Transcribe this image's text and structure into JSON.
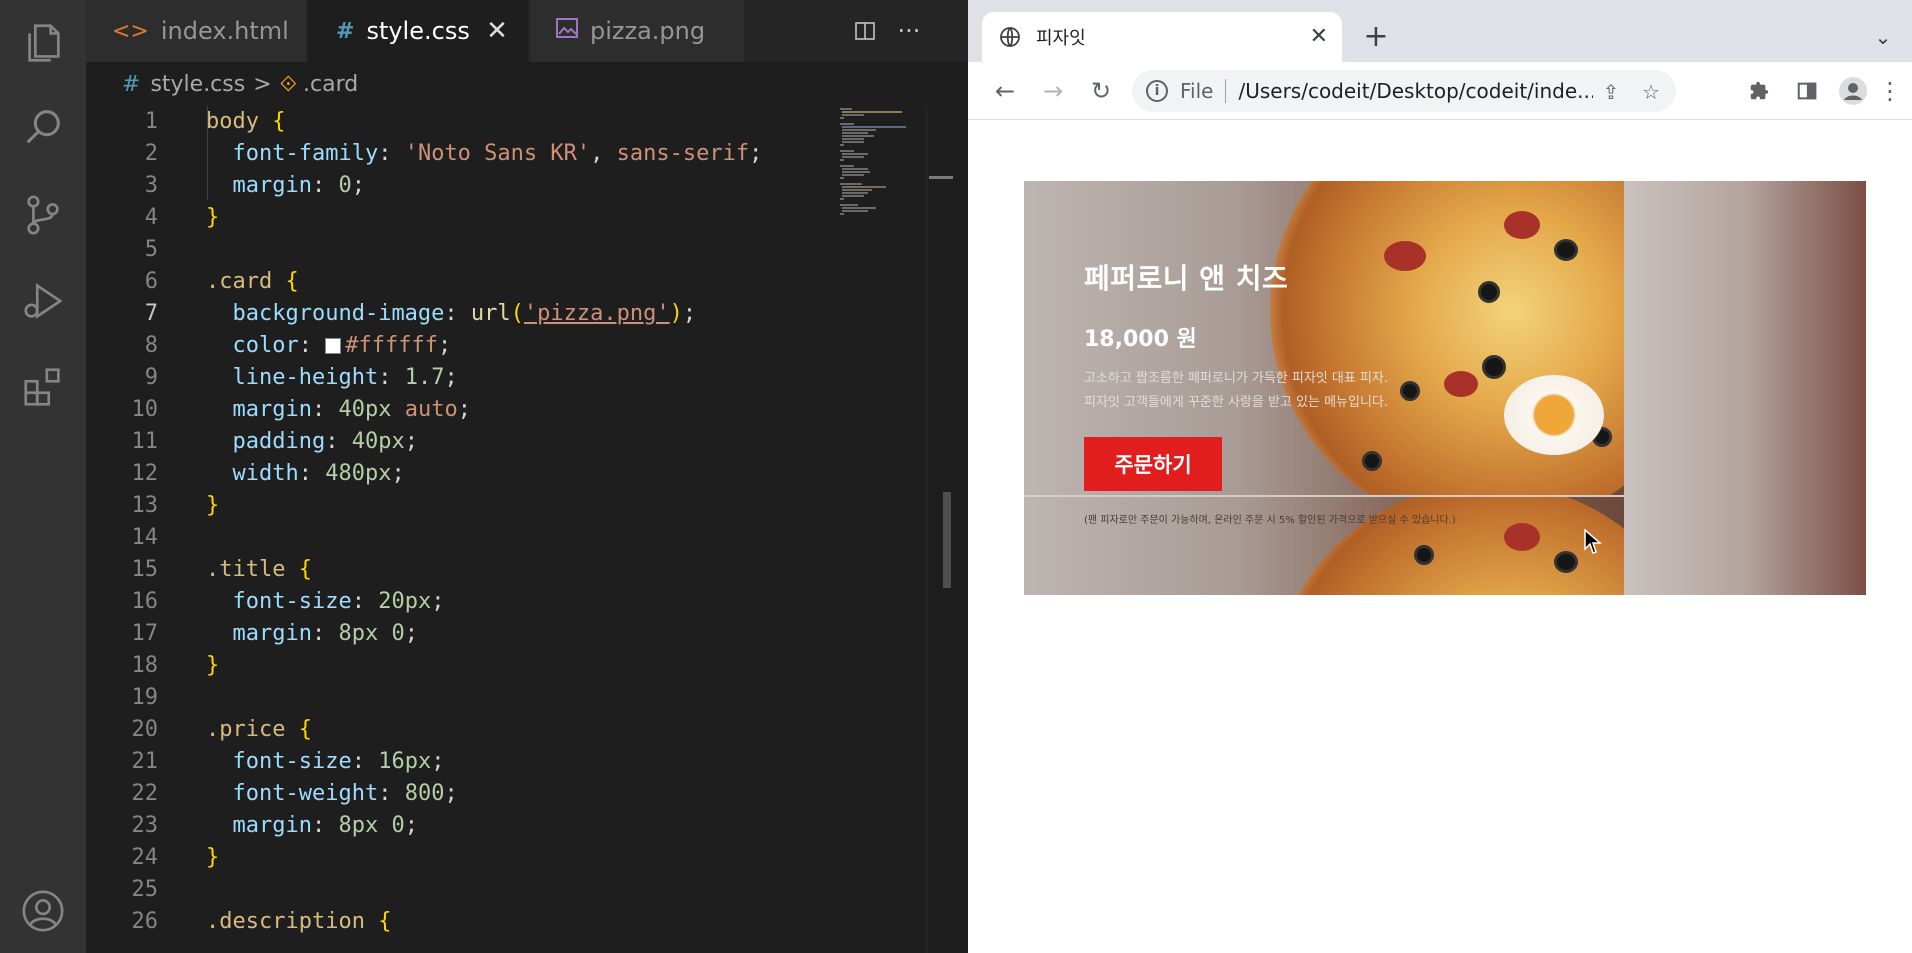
{
  "vscode": {
    "tabs": [
      {
        "label": "index.html",
        "icon": "<>"
      },
      {
        "label": "style.css",
        "icon": "#"
      },
      {
        "label": "pizza.png",
        "icon": "image-icon"
      }
    ],
    "tab_close_glyph": "✕",
    "more_glyph": "···",
    "breadcrumb": {
      "file": "style.css",
      "symbol": ".card",
      "hash": "#",
      "sep": ">",
      "sym_icon": "⟐"
    },
    "current_line": 7,
    "lines": [
      {
        "n": "1"
      },
      {
        "n": "2"
      },
      {
        "n": "3"
      },
      {
        "n": "4"
      },
      {
        "n": "5"
      },
      {
        "n": "6"
      },
      {
        "n": "7"
      },
      {
        "n": "8"
      },
      {
        "n": "9"
      },
      {
        "n": "10"
      },
      {
        "n": "11"
      },
      {
        "n": "12"
      },
      {
        "n": "13"
      },
      {
        "n": "14"
      },
      {
        "n": "15"
      },
      {
        "n": "16"
      },
      {
        "n": "17"
      },
      {
        "n": "18"
      },
      {
        "n": "19"
      },
      {
        "n": "20"
      },
      {
        "n": "21"
      },
      {
        "n": "22"
      },
      {
        "n": "23"
      },
      {
        "n": "24"
      },
      {
        "n": "25"
      },
      {
        "n": "26"
      }
    ],
    "code": {
      "l1_sel": "body",
      "l1_brace": " {",
      "l2_prop": "font-family",
      "l2_val1": "'Noto Sans KR'",
      "l2_val2": "sans-serif",
      "l3_prop": "margin",
      "l3_val": "0",
      "close_brace": "}",
      "l6_sel": ".card",
      "l6_brace": " {",
      "l7_prop": "background-image",
      "l7_fn": "url",
      "l7_arg": "'pizza.png'",
      "l8_prop": "color",
      "l8_val": "#ffffff",
      "l9_prop": "line-height",
      "l9_val": "1.7",
      "l10_prop": "margin",
      "l10_val1": "40px",
      "l10_val2": "auto",
      "l11_prop": "padding",
      "l11_val": "40px",
      "l12_prop": "width",
      "l12_val": "480px",
      "l15_sel": ".title",
      "l15_brace": " {",
      "l16_prop": "font-size",
      "l16_val": "20px",
      "l17_prop": "margin",
      "l17_val": "8px 0",
      "l20_sel": ".price",
      "l20_brace": " {",
      "l21_prop": "font-size",
      "l21_val": "16px",
      "l22_prop": "font-weight",
      "l22_val": "800",
      "l23_prop": "margin",
      "l23_val": "8px 0",
      "l26_sel": ".description",
      "l26_brace": " {"
    },
    "colors": {
      "bg": "#1e1e1e",
      "activity": "#333333",
      "selector": "#d7ba7d",
      "property": "#9cdcfe",
      "number": "#b5cea8",
      "string": "#ce9178"
    }
  },
  "chrome": {
    "tab_title": "피자잇",
    "tab_close": "✕",
    "new_tab": "+",
    "omnibox": {
      "info": "i",
      "scheme": "File",
      "url": "/Users/codeit/Desktop/codeit/inde..."
    },
    "toolbar_glyphs": {
      "back": "←",
      "forward": "→",
      "reload": "↻",
      "tab_search": "⌄",
      "share": "⇪",
      "star": "☆",
      "puzzle": "✱",
      "sidepanel": "▯",
      "menu": "⋮"
    }
  },
  "card": {
    "title": "페퍼로니 앤 치즈",
    "price": "18,000 원",
    "description_1": "고소하고 짭조름한 페퍼로니가 가득한 피자잇 대표 피자.",
    "description_2": "피자잇 고객들에게 꾸준한 사랑을 받고 있는 메뉴입니다.",
    "order_button": "주문하기",
    "note": "(팬 피자로만 주문이 가능하며, 온라인 주문 시 5% 할인된 가격으로 받으실 수 있습니다.)"
  }
}
